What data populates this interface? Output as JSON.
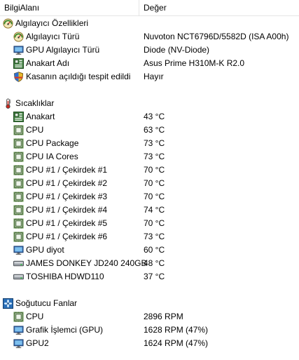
{
  "header": {
    "col_field": "BilgiAlanı",
    "col_value": "Değer"
  },
  "sections": [
    {
      "title": "Algılayıcı Özellikleri",
      "icon": "sensor-gauge-icon",
      "items": [
        {
          "label": "Algılayıcı Türü",
          "value": "Nuvoton NCT6796D/5582D  (ISA A00h)",
          "icon": "sensor-gauge-icon"
        },
        {
          "label": "GPU Algılayıcı Türü",
          "value": "Diode  (NV-Diode)",
          "icon": "monitor-icon"
        },
        {
          "label": "Anakart Adı",
          "value": "Asus Prime H310M-K R2.0",
          "icon": "motherboard-icon"
        },
        {
          "label": "Kasanın açıldığı tespit edildi",
          "value": "Hayır",
          "icon": "shield-icon"
        }
      ]
    },
    {
      "title": "Sıcaklıklar",
      "icon": "thermometer-icon",
      "items": [
        {
          "label": "Anakart",
          "value": "43 °C",
          "icon": "motherboard-icon"
        },
        {
          "label": "CPU",
          "value": "63 °C",
          "icon": "cpu-chip-icon"
        },
        {
          "label": "CPU Package",
          "value": "73 °C",
          "icon": "cpu-chip-icon"
        },
        {
          "label": "CPU IA Cores",
          "value": "73 °C",
          "icon": "cpu-chip-icon"
        },
        {
          "label": "CPU #1 / Çekirdek #1",
          "value": "70 °C",
          "icon": "cpu-chip-icon"
        },
        {
          "label": "CPU #1 / Çekirdek #2",
          "value": "70 °C",
          "icon": "cpu-chip-icon"
        },
        {
          "label": "CPU #1 / Çekirdek #3",
          "value": "70 °C",
          "icon": "cpu-chip-icon"
        },
        {
          "label": "CPU #1 / Çekirdek #4",
          "value": "74 °C",
          "icon": "cpu-chip-icon"
        },
        {
          "label": "CPU #1 / Çekirdek #5",
          "value": "70 °C",
          "icon": "cpu-chip-icon"
        },
        {
          "label": "CPU #1 / Çekirdek #6",
          "value": "73 °C",
          "icon": "cpu-chip-icon"
        },
        {
          "label": "GPU diyot",
          "value": "60 °C",
          "icon": "monitor-icon"
        },
        {
          "label": "JAMES DONKEY JD240 240GB",
          "value": "48 °C",
          "icon": "drive-icon"
        },
        {
          "label": "TOSHIBA HDWD110",
          "value": "37 °C",
          "icon": "drive-icon"
        }
      ]
    },
    {
      "title": "Soğutucu Fanlar",
      "icon": "fan-icon",
      "items": [
        {
          "label": "CPU",
          "value": "2896 RPM",
          "icon": "cpu-chip-icon"
        },
        {
          "label": "Grafik İşlemci (GPU)",
          "value": "1628 RPM  (47%)",
          "icon": "monitor-icon"
        },
        {
          "label": "GPU2",
          "value": "1624 RPM  (47%)",
          "icon": "monitor-icon"
        }
      ]
    }
  ]
}
